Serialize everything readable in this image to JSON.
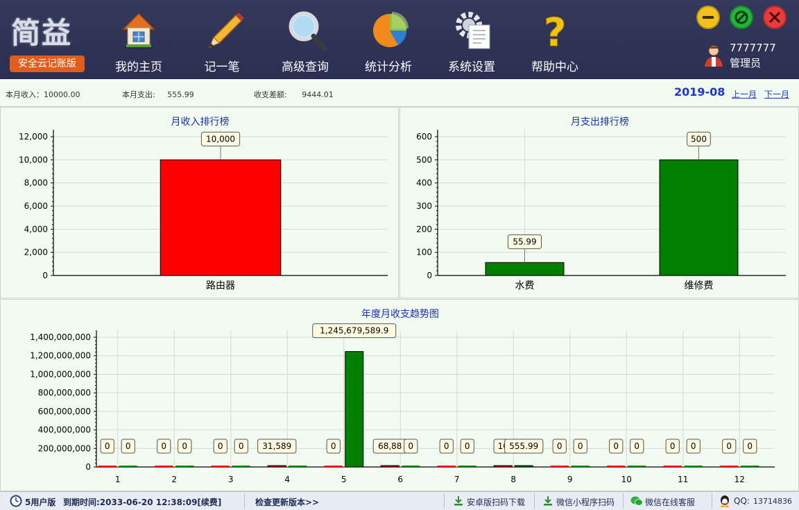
{
  "app": {
    "logo_text": "简益",
    "edition": "安全云记账版"
  },
  "toolbar": [
    {
      "label": "我的主页",
      "icon": "home-icon"
    },
    {
      "label": "记一笔",
      "icon": "pencil-icon"
    },
    {
      "label": "高级查询",
      "icon": "magnifier-icon"
    },
    {
      "label": "统计分析",
      "icon": "pie-chart-icon"
    },
    {
      "label": "系统设置",
      "icon": "gear-settings-icon"
    },
    {
      "label": "帮助中心",
      "icon": "question-icon"
    }
  ],
  "window_controls": {
    "minimize_color": "#f2c21b",
    "maximize_color": "#21b33a",
    "close_color": "#e83b3b"
  },
  "user": {
    "id": "7777777",
    "role": "管理员"
  },
  "summary": {
    "income_label": "本月收入：",
    "income_value": "10000.00",
    "expense_label": "本月支出:",
    "expense_value": "555.99",
    "diff_label": "收支差额:",
    "diff_value": "9444.01",
    "period": "2019-08",
    "prev_label": "上一月",
    "next_label": "下一月"
  },
  "chart_data": [
    {
      "type": "bar",
      "title": "月收入排行榜",
      "categories": [
        "路由器"
      ],
      "values": [
        10000
      ],
      "value_labels": [
        "10,000"
      ],
      "ylim": [
        0,
        12000
      ],
      "yticks": [
        0,
        2000,
        4000,
        6000,
        8000,
        10000,
        12000
      ],
      "ytick_labels": [
        "0",
        "2,000",
        "4,000",
        "6,000",
        "8,000",
        "10,000",
        "12,000"
      ],
      "color": "#ff0000",
      "grid": true
    },
    {
      "type": "bar",
      "title": "月支出排行榜",
      "categories": [
        "水费",
        "维修费"
      ],
      "values": [
        55.99,
        500
      ],
      "value_labels": [
        "55.99",
        "500"
      ],
      "ylim": [
        0,
        600
      ],
      "yticks": [
        0,
        100,
        200,
        300,
        400,
        500,
        600
      ],
      "ytick_labels": [
        "0",
        "100",
        "200",
        "300",
        "400",
        "500",
        "600"
      ],
      "color": "#008000",
      "grid": true
    },
    {
      "type": "bar",
      "title": "年度月收支趋势图",
      "categories": [
        "1",
        "2",
        "3",
        "4",
        "5",
        "6",
        "7",
        "8",
        "9",
        "10",
        "11",
        "12"
      ],
      "series": [
        {
          "values": [
            0,
            0,
            0,
            31589,
            0,
            68880,
            0,
            10000,
            0,
            0,
            0,
            0
          ],
          "labels": [
            "0",
            "0",
            "0",
            "31,589",
            "0",
            "68,88",
            "0",
            "10",
            "0",
            "0",
            "0",
            "0"
          ],
          "color": "#ff0000"
        },
        {
          "values": [
            0,
            0,
            0,
            0,
            1245679589.9,
            0,
            0,
            555.99,
            0,
            0,
            0,
            0
          ],
          "labels": [
            "0",
            "0",
            "0",
            "",
            "1,245,679,589.9",
            "0",
            "0",
            "555.99",
            "0",
            "0",
            "0",
            "0"
          ],
          "color": "#008000"
        }
      ],
      "ylim": [
        0,
        1400000000
      ],
      "yticks": [
        0,
        200000000,
        400000000,
        600000000,
        800000000,
        1000000000,
        1200000000,
        1400000000
      ],
      "ytick_labels": [
        "0",
        "200,000,000",
        "400,000,000",
        "600,000,000",
        "800,000,000",
        "1,000,000,000",
        "1,200,000,000",
        "1,400,000,000"
      ],
      "grid": true
    }
  ],
  "status": {
    "version": "5用户版",
    "expire": "到期时间:2033-06-20 12:38:09[续费]",
    "update": "检查更新版本>>",
    "android": "安卓版扫码下载",
    "miniprogram": "微信小程序扫码",
    "wechat_service": "微信在线客服",
    "qq_label": "QQ:",
    "qq_value": "13714836"
  }
}
